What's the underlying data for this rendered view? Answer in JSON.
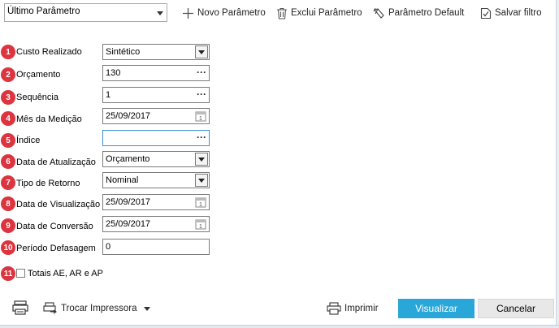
{
  "toolbar": {
    "param_select_value": "Último Parâmetro",
    "novo_label": "Novo Parâmetro",
    "exclui_label": "Exclui Parâmetro",
    "default_label": "Parâmetro Default",
    "salvar_label": "Salvar filtro"
  },
  "fields": [
    {
      "num": "1",
      "label": "Custo Realizado",
      "value": "Sintético",
      "kind": "dropdown"
    },
    {
      "num": "2",
      "label": "Orçamento",
      "value": "130",
      "kind": "lookup"
    },
    {
      "num": "3",
      "label": "Sequência",
      "value": "1",
      "kind": "lookup"
    },
    {
      "num": "4",
      "label": "Mês da Medição",
      "value": "25/09/2017",
      "kind": "date"
    },
    {
      "num": "5",
      "label": "Índice",
      "value": "",
      "kind": "lookup"
    },
    {
      "num": "6",
      "label": "Data de Atualização",
      "value": "Orçamento",
      "kind": "dropdown"
    },
    {
      "num": "7",
      "label": "Tipo de Retorno",
      "value": "Nominal",
      "kind": "dropdown"
    },
    {
      "num": "8",
      "label": "Data de Visualização",
      "value": "25/09/2017",
      "kind": "date"
    },
    {
      "num": "9",
      "label": "Data de Conversão",
      "value": "25/09/2017",
      "kind": "date"
    },
    {
      "num": "10",
      "label": "Período Defasagem",
      "value": "0",
      "kind": "text"
    }
  ],
  "totals": {
    "num": "11",
    "label": "Totais AE, AR e AP",
    "checked": false
  },
  "footer": {
    "trocar_label": "Trocar Impressora",
    "imprimir_label": "Imprimir",
    "visualizar_label": "Visualizar",
    "cancelar_label": "Cancelar"
  },
  "colors": {
    "badge": "#dc3540",
    "primary_button": "#29a7d8",
    "focus_border": "#3b8fd6"
  }
}
